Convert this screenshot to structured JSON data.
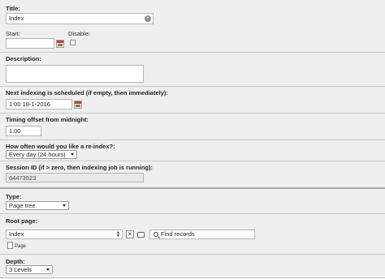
{
  "title_field": {
    "label": "Title:",
    "value": "Index"
  },
  "start_field": {
    "label": "Start:",
    "value": ""
  },
  "disable_field": {
    "label": "Disable:",
    "checked": false
  },
  "description_field": {
    "label": "Description:",
    "value": ""
  },
  "next_indexing": {
    "label": "Next indexing is scheduled (if empty, then immediately):",
    "value": "1:00 18-1-2016"
  },
  "timing_offset": {
    "label": "Timing offset from midnight:",
    "value": "1:00"
  },
  "reindex_frequency": {
    "label": "How often would you like a re-index?:",
    "selected": "Every day (24 hours)"
  },
  "session_id": {
    "label": "Session ID (if > zero, then indexing job is running):",
    "value": "64473523"
  },
  "type_field": {
    "label": "Type:",
    "selected": "Page tree"
  },
  "root_page": {
    "label": "Root page:",
    "selected": "Index",
    "find_placeholder": "Find records",
    "record_label": "Page"
  },
  "depth_field": {
    "label": "Depth:",
    "selected": "3 Levels"
  }
}
